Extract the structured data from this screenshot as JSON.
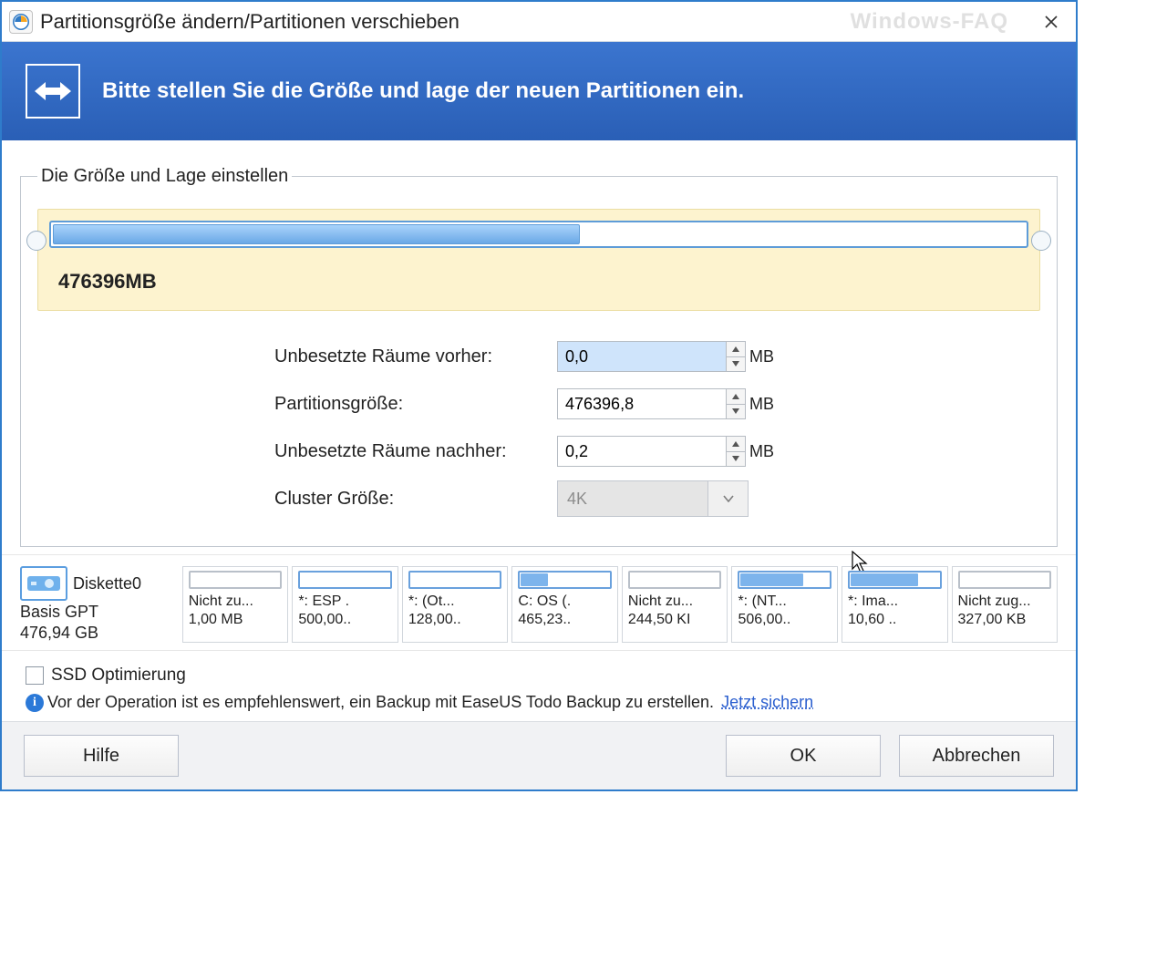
{
  "title": "Partitionsgröße ändern/Partitionen verschieben",
  "watermark": "Windows-FAQ",
  "banner_text": "Bitte stellen Sie die Größe und lage der neuen Partitionen ein.",
  "legend": "Die Größe und Lage einstellen",
  "slider_size_label": "476396MB",
  "form": {
    "before_label": "Unbesetzte Räume vorher:",
    "before_value": "0,0",
    "size_label": "Partitionsgröße:",
    "size_value": "476396,8",
    "after_label": "Unbesetzte Räume nachher:",
    "after_value": "0,2",
    "cluster_label": "Cluster Größe:",
    "cluster_value": "4K",
    "unit": "MB"
  },
  "disk": {
    "name": "Diskette0",
    "type": "Basis GPT",
    "total": "476,94 GB",
    "partitions": [
      {
        "label": "Nicht zu...",
        "size": "1,00 MB",
        "fill": 0,
        "colored": false
      },
      {
        "label": "*: ESP .",
        "size": "500,00..",
        "fill": 0,
        "colored": true
      },
      {
        "label": "*: (Ot...",
        "size": "128,00..",
        "fill": 0,
        "colored": true
      },
      {
        "label": "C: OS (.",
        "size": "465,23..",
        "fill": 30,
        "colored": true
      },
      {
        "label": "Nicht zu...",
        "size": "244,50 KI",
        "fill": 0,
        "colored": false
      },
      {
        "label": "*: (NT...",
        "size": "506,00..",
        "fill": 70,
        "colored": true
      },
      {
        "label": "*: Ima...",
        "size": "10,60 ..",
        "fill": 75,
        "colored": true
      },
      {
        "label": "Nicht zug...",
        "size": "327,00 KB",
        "fill": 0,
        "colored": false
      }
    ]
  },
  "ssd_label": "SSD Optimierung",
  "info_text": "Vor der Operation ist es empfehlenswert, ein Backup mit  EaseUS Todo Backup zu erstellen.",
  "info_link": "Jetzt sichern",
  "buttons": {
    "help": "Hilfe",
    "ok": "OK",
    "cancel": "Abbrechen"
  }
}
